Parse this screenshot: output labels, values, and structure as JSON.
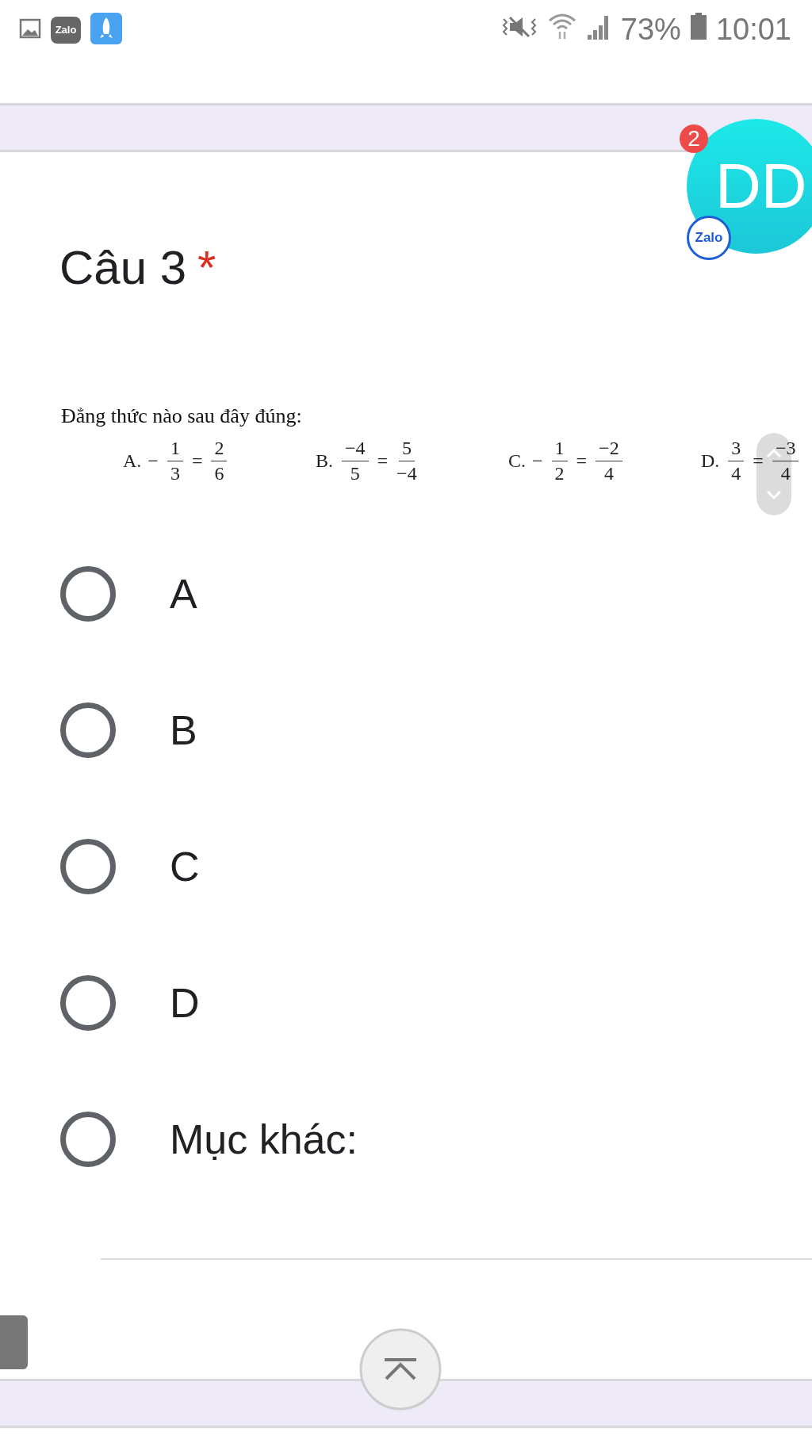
{
  "status_bar": {
    "notifications": [
      {
        "kind": "image"
      },
      {
        "kind": "chat",
        "label": "Zalo"
      },
      {
        "kind": "rocket"
      }
    ],
    "battery": "73%",
    "time": "10:01"
  },
  "chat_bubble": {
    "avatar": "DD",
    "badge": "2",
    "app_label": "Zalo"
  },
  "question": {
    "title": "Câu 3",
    "required_mark": "*",
    "prompt": "Đẳng thức nào sau đây đúng:",
    "equations": [
      {
        "label": "A.",
        "terms": [
          {
            "kind": "sign",
            "text": "−"
          },
          {
            "kind": "frac",
            "num": "1",
            "den": "3"
          },
          {
            "kind": "sign",
            "text": "="
          },
          {
            "kind": "frac",
            "num": "2",
            "den": "6"
          }
        ]
      },
      {
        "label": "B.",
        "terms": [
          {
            "kind": "frac",
            "num": "−4",
            "den": "5"
          },
          {
            "kind": "sign",
            "text": "="
          },
          {
            "kind": "frac",
            "num": "5",
            "den": "−4"
          }
        ]
      },
      {
        "label": "C.",
        "terms": [
          {
            "kind": "sign",
            "text": "−"
          },
          {
            "kind": "frac",
            "num": "1",
            "den": "2"
          },
          {
            "kind": "sign",
            "text": "="
          },
          {
            "kind": "frac",
            "num": "−2",
            "den": "4"
          }
        ]
      },
      {
        "label": "D.",
        "terms": [
          {
            "kind": "frac",
            "num": "3",
            "den": "4"
          },
          {
            "kind": "sign",
            "text": "="
          },
          {
            "kind": "frac",
            "num": "−3",
            "den": "4"
          }
        ]
      }
    ],
    "choices": [
      {
        "label": "A",
        "selected": false
      },
      {
        "label": "B",
        "selected": false
      },
      {
        "label": "C",
        "selected": false
      },
      {
        "label": "D",
        "selected": false
      },
      {
        "label": "Mục khác:",
        "selected": false
      }
    ]
  }
}
